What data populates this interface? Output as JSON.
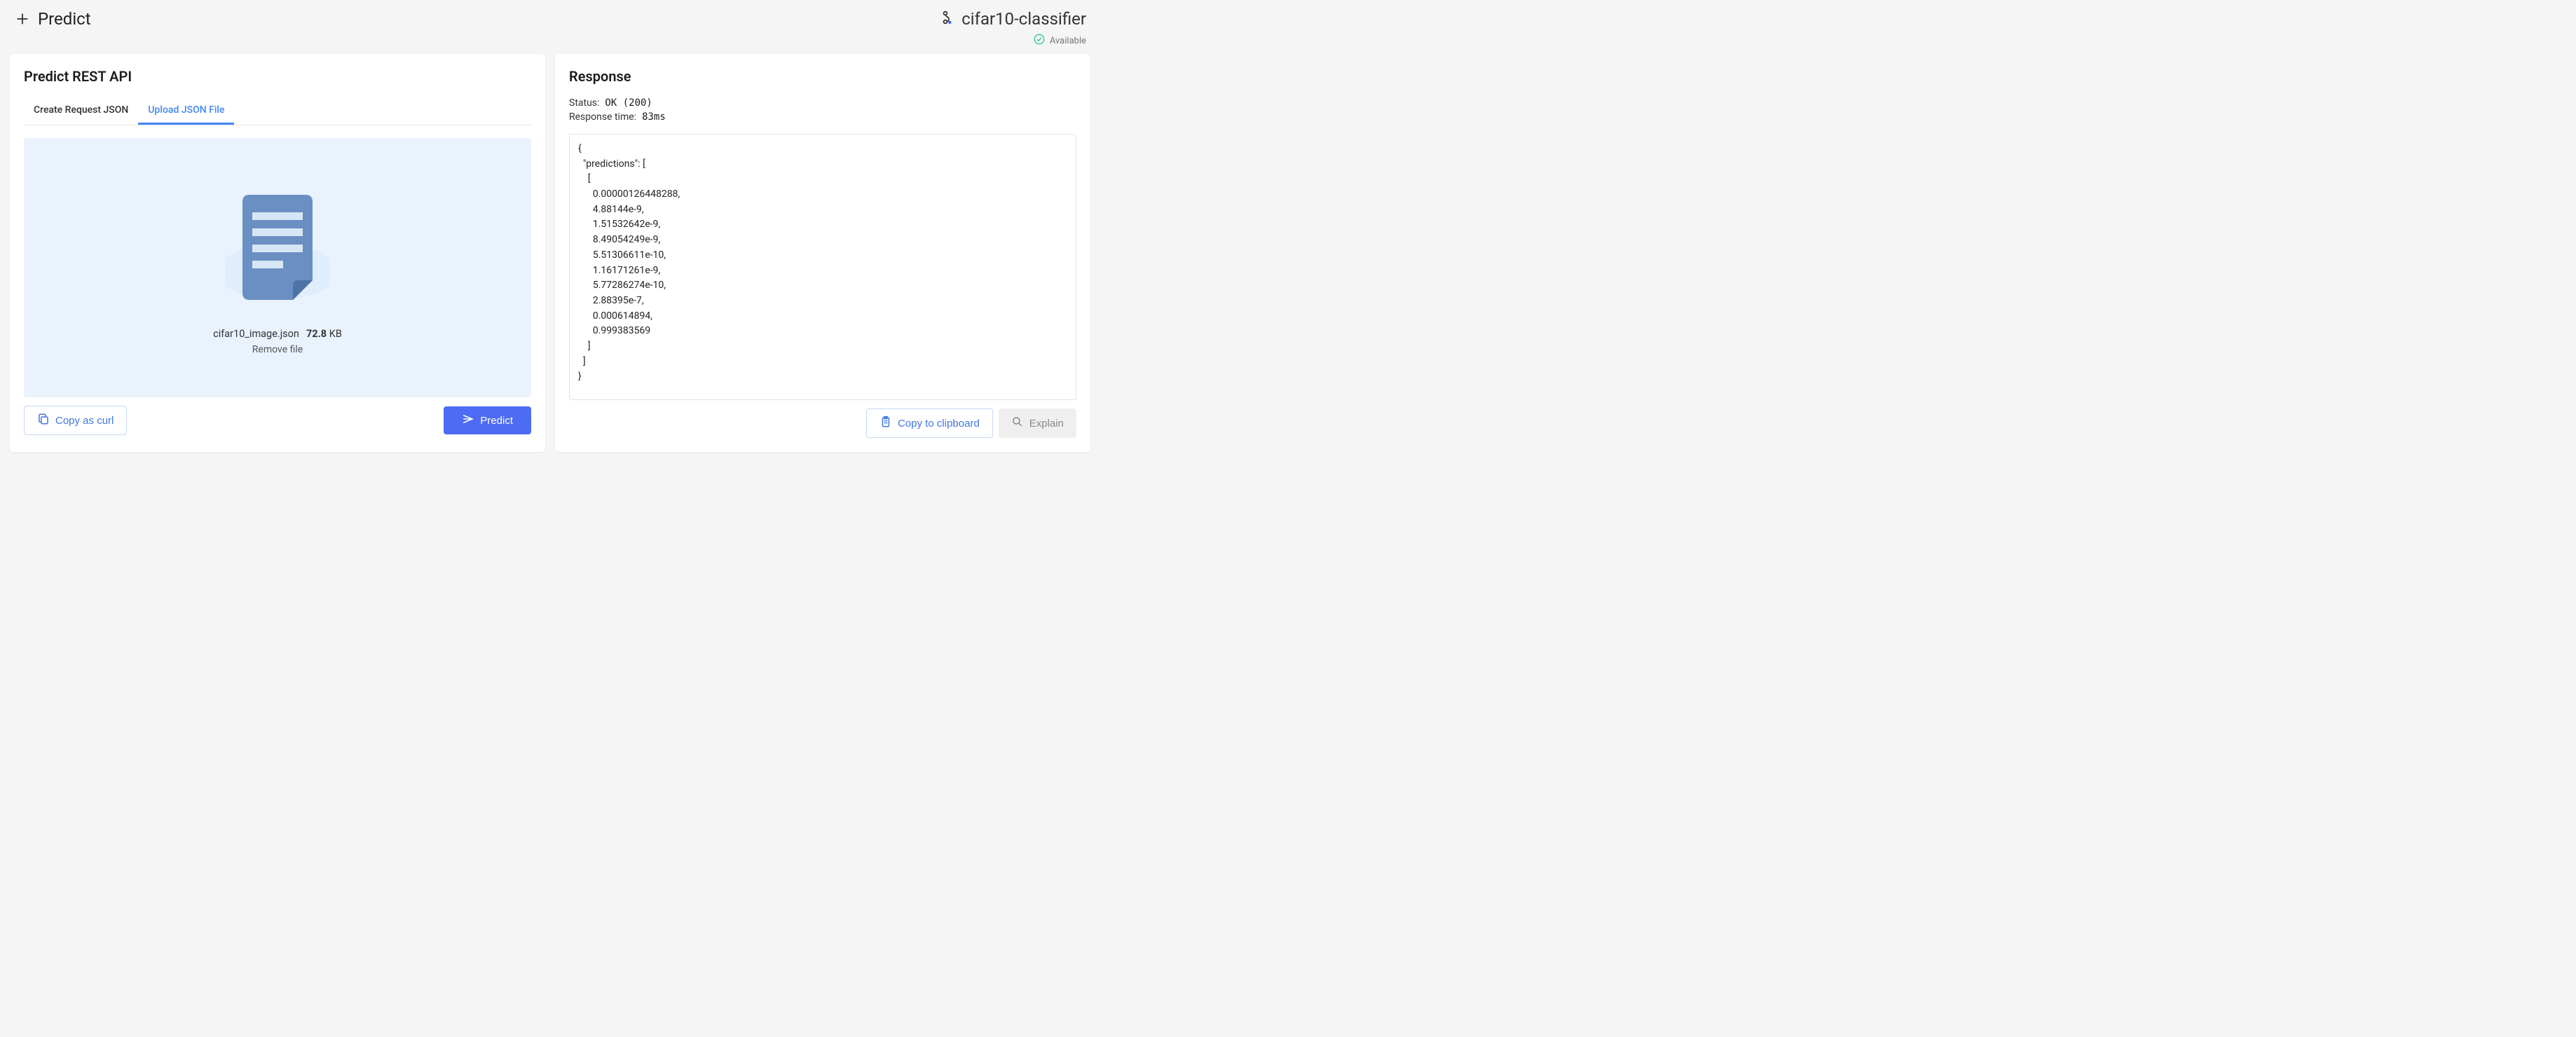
{
  "page_title": "Predict",
  "model": {
    "name": "cifar10-classifier",
    "status": "Available"
  },
  "left": {
    "title": "Predict REST API",
    "tabs": [
      {
        "label": "Create Request JSON",
        "active": false
      },
      {
        "label": "Upload JSON File",
        "active": true
      }
    ],
    "file": {
      "name": "cifar10_image.json",
      "size_num": "72.8",
      "size_unit": "KB",
      "remove_label": "Remove file"
    },
    "copy_curl_label": "Copy as curl",
    "predict_label": "Predict"
  },
  "right": {
    "title": "Response",
    "status_label": "Status:",
    "status_value": "OK (200)",
    "time_label": "Response time:",
    "time_value": "83ms",
    "body": "{\n  \"predictions\": [\n    [\n      0.00000126448288,\n      4.88144e-9,\n      1.51532642e-9,\n      8.49054249e-9,\n      5.51306611e-10,\n      1.16171261e-9,\n      5.77286274e-10,\n      2.88395e-7,\n      0.000614894,\n      0.999383569\n    ]\n  ]\n}",
    "copy_clip_label": "Copy to clipboard",
    "explain_label": "Explain"
  }
}
